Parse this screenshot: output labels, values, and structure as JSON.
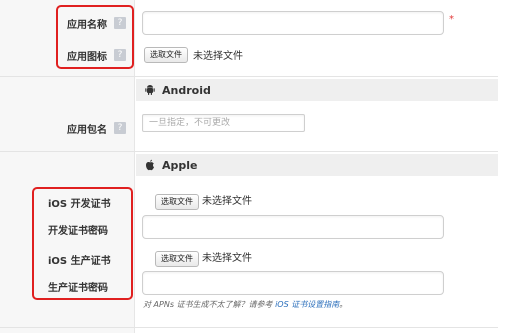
{
  "colors": {
    "accent": "#e02020",
    "link": "#2a6ebb",
    "required": "#e23b3b"
  },
  "app_section": {
    "app_name_label": "应用名称",
    "app_icon_label": "应用图标",
    "help_glyph": "?",
    "required_mark": "*",
    "file_button": "选取文件",
    "no_file": "未选择文件"
  },
  "android": {
    "title": "Android",
    "icon": "android-icon",
    "package_label": "应用包名",
    "package_placeholder": "一旦指定，不可更改"
  },
  "apple": {
    "title": "Apple",
    "icon": "apple-icon",
    "dev_cert_label": "iOS 开发证书",
    "dev_cert_pwd_label": "开发证书密码",
    "prod_cert_label": "iOS 生产证书",
    "prod_cert_pwd_label": "生产证书密码",
    "file_button": "选取文件",
    "no_file": "未选择文件",
    "hint_text": "对 APNs 证书生成不太了解？请参考 ",
    "hint_link": "iOS 证书设置指南",
    "hint_end": "。"
  }
}
